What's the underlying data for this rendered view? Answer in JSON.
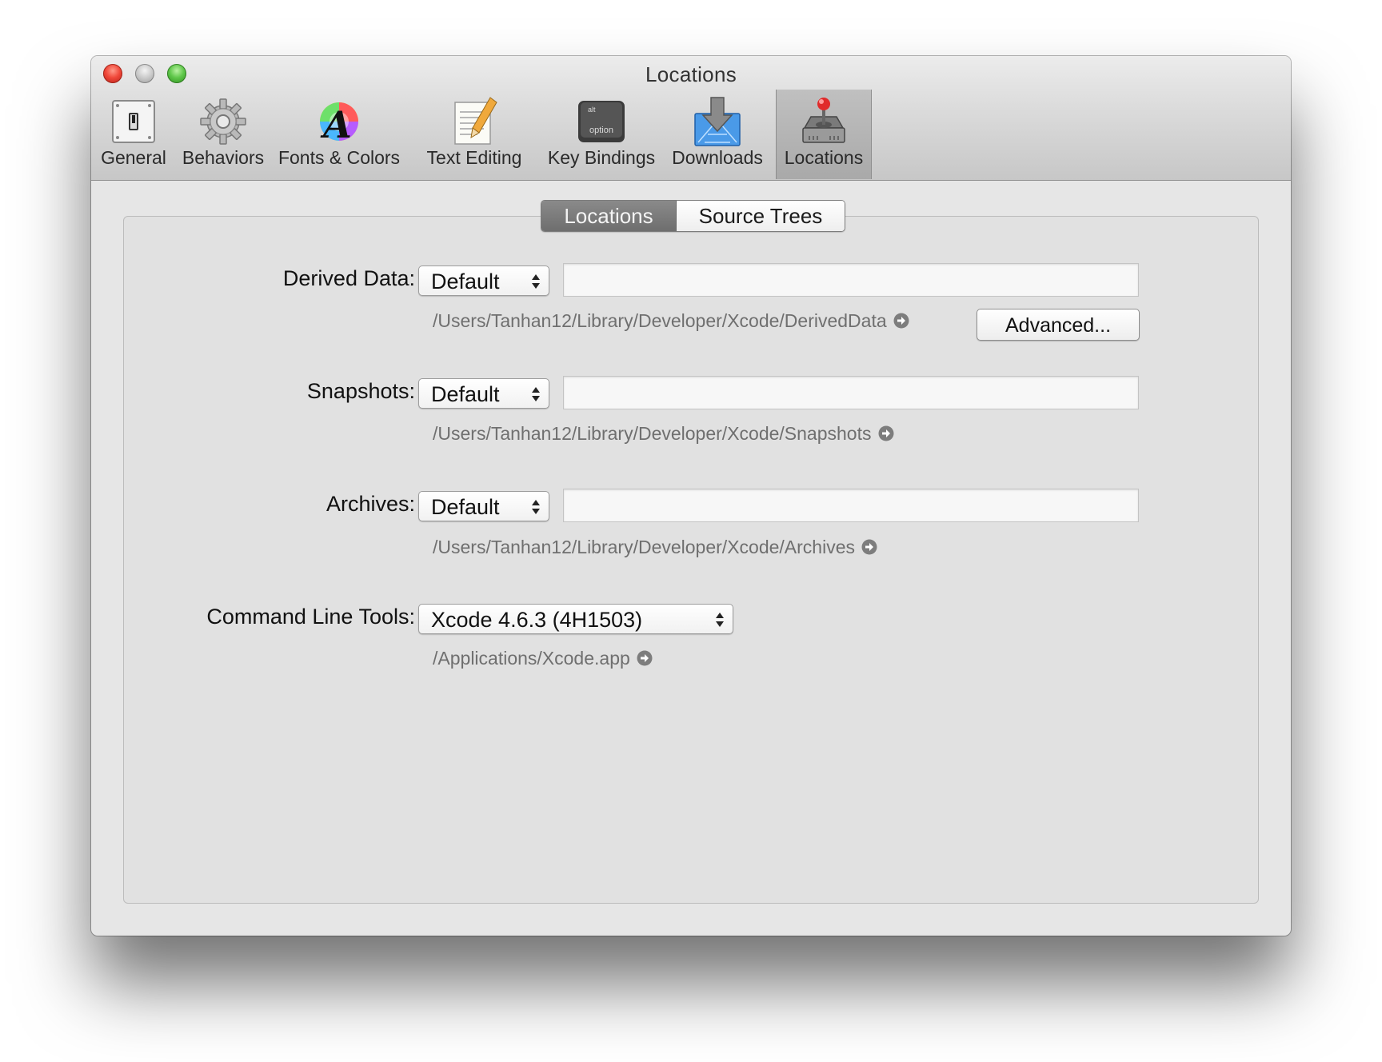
{
  "window": {
    "title": "Locations"
  },
  "toolbar": {
    "items": [
      {
        "label": "General",
        "icon": "toggle-switch-icon"
      },
      {
        "label": "Behaviors",
        "icon": "gear-icon"
      },
      {
        "label": "Fonts & Colors",
        "icon": "color-font-icon"
      },
      {
        "label": "Text Editing",
        "icon": "document-pencil-icon"
      },
      {
        "label": "Key Bindings",
        "icon": "option-key-icon"
      },
      {
        "label": "Downloads",
        "icon": "download-arrow-icon"
      },
      {
        "label": "Locations",
        "icon": "joystick-drive-icon"
      }
    ],
    "selected": "Locations"
  },
  "tabs": {
    "items": [
      "Locations",
      "Source Trees"
    ],
    "selected": "Locations"
  },
  "settings": {
    "derived_data": {
      "label": "Derived Data:",
      "popup_value": "Default",
      "field_value": "",
      "path": "/Users/Tanhan12/Library/Developer/Xcode/DerivedData"
    },
    "advanced_button": "Advanced...",
    "snapshots": {
      "label": "Snapshots:",
      "popup_value": "Default",
      "field_value": "",
      "path": "/Users/Tanhan12/Library/Developer/Xcode/Snapshots"
    },
    "archives": {
      "label": "Archives:",
      "popup_value": "Default",
      "field_value": "",
      "path": "/Users/Tanhan12/Library/Developer/Xcode/Archives"
    },
    "command_line_tools": {
      "label": "Command Line Tools:",
      "popup_value": "Xcode 4.6.3 (4H1503)",
      "path": "/Applications/Xcode.app"
    }
  },
  "colors": {
    "close": "#f0483a",
    "minimize": "#c8c8c8",
    "zoom": "#5fc74a",
    "selected_segment": "#7c7c7c",
    "path_text": "#6f6f6f"
  }
}
